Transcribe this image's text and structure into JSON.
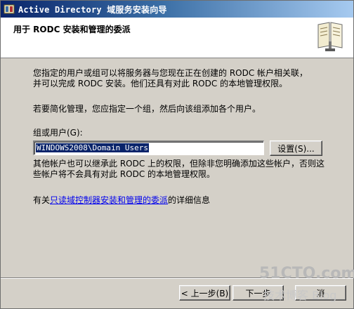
{
  "window": {
    "title": "Active Directory 域服务安装向导"
  },
  "header": {
    "title": "用于 RODC 安装和管理的委派"
  },
  "content": {
    "para1_line1": "您指定的用户或组可以将服务器与您现在正在创建的 RODC 帐户相关联，",
    "para1_line2": "并可以完成 RODC 安装。他们还具有对此 RODC 的本地管理权限。",
    "para2": "若要简化管理，您应指定一个组，然后向该组添加各个用户。",
    "group_label": "组或用户(G):",
    "group_value": "WINDOWS2008\\Domain Users",
    "settings_button": "设置(S)...",
    "para3_line1": "其他帐户也可以继承此 RODC 上的权限，但除非您明确添加这些帐户，否则这",
    "para3_line2": "些帐户将不会具有对此 RODC 的本地管理权限。",
    "more_info_prefix": "有关",
    "more_info_link": "只读域控制器安装和管理的委派",
    "more_info_suffix": "的详细信息"
  },
  "footer": {
    "back_button": "< 上一步(B)",
    "next_button": "下一步",
    "cancel_button": "消"
  },
  "watermark": {
    "site": "51CTO.com",
    "tagline": "技术博客 Blog"
  }
}
